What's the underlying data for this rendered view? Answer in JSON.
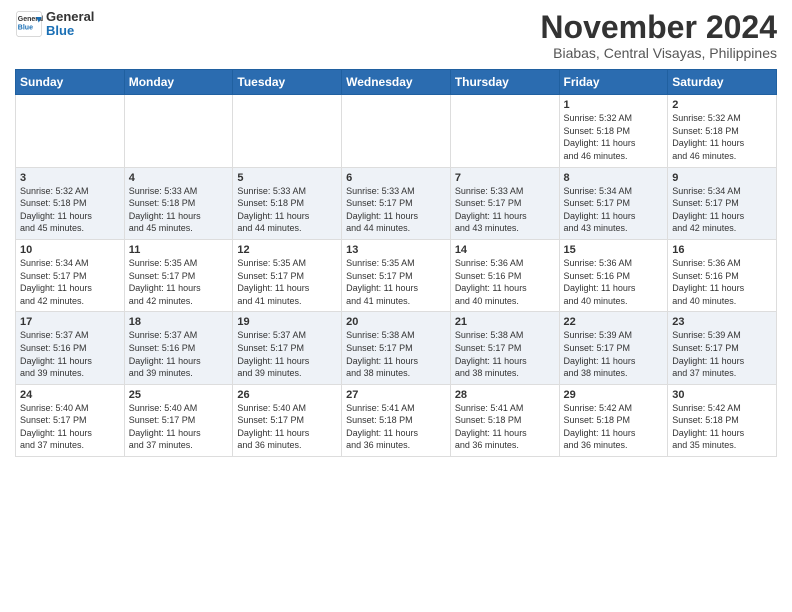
{
  "logo": {
    "general": "General",
    "blue": "Blue"
  },
  "title": "November 2024",
  "subtitle": "Biabas, Central Visayas, Philippines",
  "days_of_week": [
    "Sunday",
    "Monday",
    "Tuesday",
    "Wednesday",
    "Thursday",
    "Friday",
    "Saturday"
  ],
  "weeks": [
    [
      {
        "day": "",
        "info": ""
      },
      {
        "day": "",
        "info": ""
      },
      {
        "day": "",
        "info": ""
      },
      {
        "day": "",
        "info": ""
      },
      {
        "day": "",
        "info": ""
      },
      {
        "day": "1",
        "info": "Sunrise: 5:32 AM\nSunset: 5:18 PM\nDaylight: 11 hours\nand 46 minutes."
      },
      {
        "day": "2",
        "info": "Sunrise: 5:32 AM\nSunset: 5:18 PM\nDaylight: 11 hours\nand 46 minutes."
      }
    ],
    [
      {
        "day": "3",
        "info": "Sunrise: 5:32 AM\nSunset: 5:18 PM\nDaylight: 11 hours\nand 45 minutes."
      },
      {
        "day": "4",
        "info": "Sunrise: 5:33 AM\nSunset: 5:18 PM\nDaylight: 11 hours\nand 45 minutes."
      },
      {
        "day": "5",
        "info": "Sunrise: 5:33 AM\nSunset: 5:18 PM\nDaylight: 11 hours\nand 44 minutes."
      },
      {
        "day": "6",
        "info": "Sunrise: 5:33 AM\nSunset: 5:17 PM\nDaylight: 11 hours\nand 44 minutes."
      },
      {
        "day": "7",
        "info": "Sunrise: 5:33 AM\nSunset: 5:17 PM\nDaylight: 11 hours\nand 43 minutes."
      },
      {
        "day": "8",
        "info": "Sunrise: 5:34 AM\nSunset: 5:17 PM\nDaylight: 11 hours\nand 43 minutes."
      },
      {
        "day": "9",
        "info": "Sunrise: 5:34 AM\nSunset: 5:17 PM\nDaylight: 11 hours\nand 42 minutes."
      }
    ],
    [
      {
        "day": "10",
        "info": "Sunrise: 5:34 AM\nSunset: 5:17 PM\nDaylight: 11 hours\nand 42 minutes."
      },
      {
        "day": "11",
        "info": "Sunrise: 5:35 AM\nSunset: 5:17 PM\nDaylight: 11 hours\nand 42 minutes."
      },
      {
        "day": "12",
        "info": "Sunrise: 5:35 AM\nSunset: 5:17 PM\nDaylight: 11 hours\nand 41 minutes."
      },
      {
        "day": "13",
        "info": "Sunrise: 5:35 AM\nSunset: 5:17 PM\nDaylight: 11 hours\nand 41 minutes."
      },
      {
        "day": "14",
        "info": "Sunrise: 5:36 AM\nSunset: 5:16 PM\nDaylight: 11 hours\nand 40 minutes."
      },
      {
        "day": "15",
        "info": "Sunrise: 5:36 AM\nSunset: 5:16 PM\nDaylight: 11 hours\nand 40 minutes."
      },
      {
        "day": "16",
        "info": "Sunrise: 5:36 AM\nSunset: 5:16 PM\nDaylight: 11 hours\nand 40 minutes."
      }
    ],
    [
      {
        "day": "17",
        "info": "Sunrise: 5:37 AM\nSunset: 5:16 PM\nDaylight: 11 hours\nand 39 minutes."
      },
      {
        "day": "18",
        "info": "Sunrise: 5:37 AM\nSunset: 5:16 PM\nDaylight: 11 hours\nand 39 minutes."
      },
      {
        "day": "19",
        "info": "Sunrise: 5:37 AM\nSunset: 5:17 PM\nDaylight: 11 hours\nand 39 minutes."
      },
      {
        "day": "20",
        "info": "Sunrise: 5:38 AM\nSunset: 5:17 PM\nDaylight: 11 hours\nand 38 minutes."
      },
      {
        "day": "21",
        "info": "Sunrise: 5:38 AM\nSunset: 5:17 PM\nDaylight: 11 hours\nand 38 minutes."
      },
      {
        "day": "22",
        "info": "Sunrise: 5:39 AM\nSunset: 5:17 PM\nDaylight: 11 hours\nand 38 minutes."
      },
      {
        "day": "23",
        "info": "Sunrise: 5:39 AM\nSunset: 5:17 PM\nDaylight: 11 hours\nand 37 minutes."
      }
    ],
    [
      {
        "day": "24",
        "info": "Sunrise: 5:40 AM\nSunset: 5:17 PM\nDaylight: 11 hours\nand 37 minutes."
      },
      {
        "day": "25",
        "info": "Sunrise: 5:40 AM\nSunset: 5:17 PM\nDaylight: 11 hours\nand 37 minutes."
      },
      {
        "day": "26",
        "info": "Sunrise: 5:40 AM\nSunset: 5:17 PM\nDaylight: 11 hours\nand 36 minutes."
      },
      {
        "day": "27",
        "info": "Sunrise: 5:41 AM\nSunset: 5:18 PM\nDaylight: 11 hours\nand 36 minutes."
      },
      {
        "day": "28",
        "info": "Sunrise: 5:41 AM\nSunset: 5:18 PM\nDaylight: 11 hours\nand 36 minutes."
      },
      {
        "day": "29",
        "info": "Sunrise: 5:42 AM\nSunset: 5:18 PM\nDaylight: 11 hours\nand 36 minutes."
      },
      {
        "day": "30",
        "info": "Sunrise: 5:42 AM\nSunset: 5:18 PM\nDaylight: 11 hours\nand 35 minutes."
      }
    ]
  ]
}
